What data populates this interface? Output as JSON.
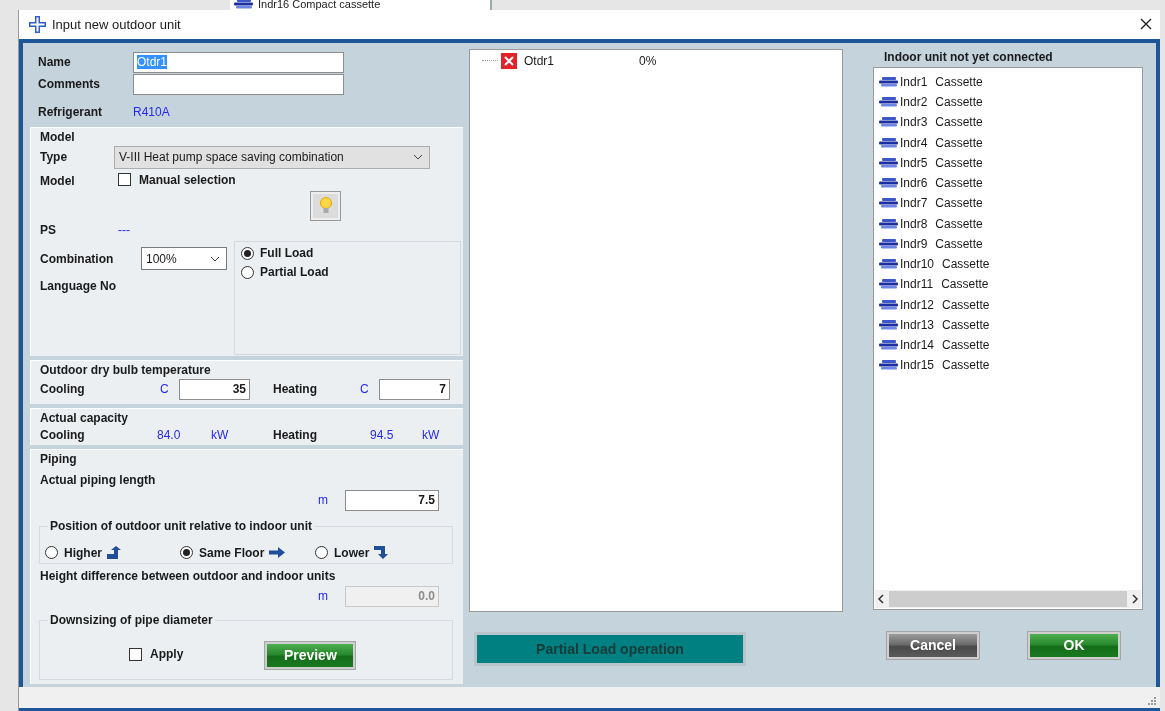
{
  "backdrop": {
    "item_label": "Indr16  Compact cassette"
  },
  "window": {
    "title": "Input new outdoor unit"
  },
  "general": {
    "name": {
      "label": "Name",
      "value": "Otdr1",
      "text_selected": true
    },
    "comments": {
      "label": "Comments"
    },
    "refrigerant": {
      "label": "Refrigerant",
      "value": "R410A"
    }
  },
  "model": {
    "title": "Model",
    "type": {
      "label": "Type",
      "value": "V-III Heat pump space saving combination"
    },
    "model_row": {
      "label": "Model",
      "manual_selection": {
        "label": "Manual selection",
        "checked": false
      }
    },
    "ps": {
      "label": "PS",
      "value": "---"
    },
    "combination": {
      "label": "Combination",
      "value": "100%"
    },
    "language_no": {
      "label": "Language No"
    },
    "load": [
      {
        "label": "Full Load",
        "selected": true
      },
      {
        "label": "Partial Load",
        "selected": false
      }
    ]
  },
  "temperature": {
    "title": "Outdoor dry bulb temperature",
    "cooling": {
      "label": "Cooling",
      "unit": "C",
      "value": "35"
    },
    "heating": {
      "label": "Heating",
      "unit": "C",
      "value": "7"
    }
  },
  "capacity": {
    "title": "Actual capacity",
    "cooling": {
      "label": "Cooling",
      "value": "84.0",
      "unit": "kW"
    },
    "heating": {
      "label": "Heating",
      "value": "94.5",
      "unit": "kW"
    }
  },
  "piping": {
    "title": "Piping",
    "length": {
      "label": "Actual piping length",
      "unit": "m",
      "value": "7.5"
    },
    "position": {
      "title": "Position of outdoor unit relative to indoor unit",
      "options": [
        {
          "label": "Higher",
          "selected": false
        },
        {
          "label": "Same Floor",
          "selected": true
        },
        {
          "label": "Lower",
          "selected": false
        }
      ]
    },
    "height_difference": {
      "label": "Height difference between outdoor and indoor units",
      "unit": "m",
      "value": "0.0",
      "disabled": true
    },
    "downsizing": {
      "title": "Downsizing of pipe diameter",
      "apply": {
        "label": "Apply",
        "checked": false
      },
      "preview_button": "Preview"
    }
  },
  "tree": [
    {
      "label": "Otdr1",
      "reading": "0%"
    }
  ],
  "partial_load_button": "Partial Load operation",
  "indoor_units": {
    "title": "Indoor unit not yet connected",
    "items": [
      {
        "id": "Indr1",
        "type": "Cassette"
      },
      {
        "id": "Indr2",
        "type": "Cassette"
      },
      {
        "id": "Indr3",
        "type": "Cassette"
      },
      {
        "id": "Indr4",
        "type": "Cassette"
      },
      {
        "id": "Indr5",
        "type": "Cassette"
      },
      {
        "id": "Indr6",
        "type": "Cassette"
      },
      {
        "id": "Indr7",
        "type": "Cassette"
      },
      {
        "id": "Indr8",
        "type": "Cassette"
      },
      {
        "id": "Indr9",
        "type": "Cassette"
      },
      {
        "id": "Indr10",
        "type": "Cassette"
      },
      {
        "id": "Indr11",
        "type": "Cassette"
      },
      {
        "id": "Indr12",
        "type": "Cassette"
      },
      {
        "id": "Indr13",
        "type": "Cassette"
      },
      {
        "id": "Indr14",
        "type": "Cassette"
      },
      {
        "id": "Indr15",
        "type": "Cassette"
      }
    ]
  },
  "buttons": [
    {
      "label": "Cancel",
      "kind": "cancel"
    },
    {
      "label": "OK",
      "kind": "ok"
    }
  ]
}
